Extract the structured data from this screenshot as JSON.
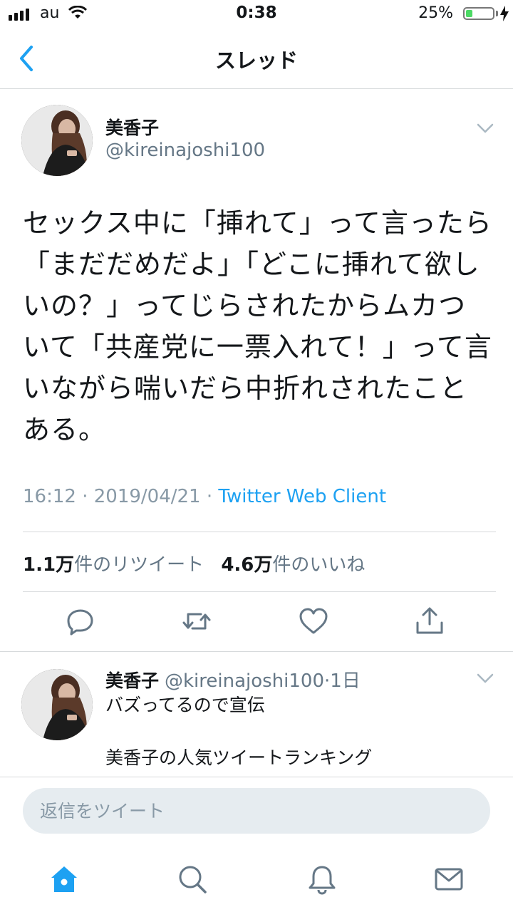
{
  "status_bar": {
    "carrier": "au",
    "time": "0:38",
    "battery_percent_label": "25%",
    "battery_level": 0.25,
    "battery_color": "#4cd964"
  },
  "nav": {
    "title": "スレッド",
    "back_icon": "chevron-left-icon"
  },
  "tweet": {
    "display_name": "美香子",
    "handle": "@kireinajoshi100",
    "text": "セックス中に「挿れて」って言ったら「まだだめだよ」「どこに挿れて欲しいの？」ってじらされたからムカついて「共産党に一票入れて！」って言いながら喘いだら中折れされたことある。",
    "time": "16:12",
    "date": "2019/04/21",
    "separator": "·",
    "client": "Twitter Web Client",
    "retweet_count": "1.1万",
    "retweet_label": "件のリツイート",
    "like_count": "4.6万",
    "like_label": "件のいいね",
    "actions": [
      "reply-icon",
      "retweet-icon",
      "like-icon",
      "share-icon"
    ]
  },
  "reply": {
    "display_name": "美香子",
    "handle": "@kireinajoshi100",
    "separator": "·",
    "time_ago": "1日",
    "line1": "バズってるので宣伝",
    "line2": "美香子の人気ツイートランキング"
  },
  "reply_bar": {
    "placeholder": "返信をツイート"
  },
  "tabs": [
    "home-icon",
    "search-icon",
    "notifications-icon",
    "messages-icon"
  ],
  "colors": {
    "accent": "#1da1f2",
    "text": "#14171a",
    "secondary": "#657786",
    "divider": "#d6d9db"
  }
}
